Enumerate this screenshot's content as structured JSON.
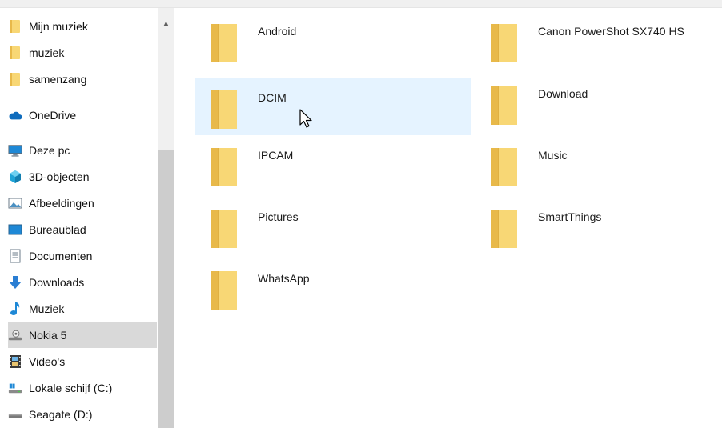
{
  "sidebar": {
    "items": [
      {
        "label": "Mijn muziek",
        "icon": "folder-icon"
      },
      {
        "label": "muziek",
        "icon": "folder-icon"
      },
      {
        "label": "samenzang",
        "icon": "folder-icon"
      },
      {
        "label": "OneDrive",
        "icon": "cloud-icon"
      },
      {
        "label": "Deze pc",
        "icon": "computer-icon"
      },
      {
        "label": "3D-objecten",
        "icon": "cube-icon"
      },
      {
        "label": "Afbeeldingen",
        "icon": "pictures-icon"
      },
      {
        "label": "Bureaublad",
        "icon": "desktop-icon"
      },
      {
        "label": "Documenten",
        "icon": "documents-icon"
      },
      {
        "label": "Downloads",
        "icon": "download-arrow-icon"
      },
      {
        "label": "Muziek",
        "icon": "music-note-icon"
      },
      {
        "label": "Nokia 5",
        "icon": "phone-device-icon",
        "selected": true
      },
      {
        "label": "Video's",
        "icon": "video-film-icon"
      },
      {
        "label": "Lokale schijf (C:)",
        "icon": "windows-drive-icon"
      },
      {
        "label": "Seagate (D:)",
        "icon": "drive-icon"
      }
    ]
  },
  "content": {
    "folders": [
      {
        "name": "Android"
      },
      {
        "name": "Canon PowerShot SX740 HS"
      },
      {
        "name": "DCIM",
        "hovered": true
      },
      {
        "name": "Download"
      },
      {
        "name": "IPCAM"
      },
      {
        "name": "Music"
      },
      {
        "name": "Pictures"
      },
      {
        "name": "SmartThings"
      },
      {
        "name": "WhatsApp"
      }
    ]
  },
  "colors": {
    "selection": "#d9d9d9",
    "hover": "#e5f3ff",
    "folder": "#f8d775",
    "folder_dark": "#e8b94a"
  }
}
